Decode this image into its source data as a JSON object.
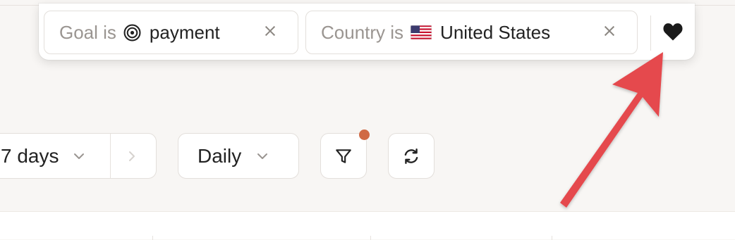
{
  "filters": [
    {
      "label": "Goal is",
      "icon": "target-icon",
      "value": "payment"
    },
    {
      "label": "Country is",
      "icon": "us-flag-icon",
      "value": "United States"
    }
  ],
  "favorite_icon": "heart-icon",
  "toolbar": {
    "date_range": "7 days",
    "interval": "Daily"
  },
  "colors": {
    "filter_indicator": "#d06a44",
    "annotation_arrow": "#e5484d"
  }
}
